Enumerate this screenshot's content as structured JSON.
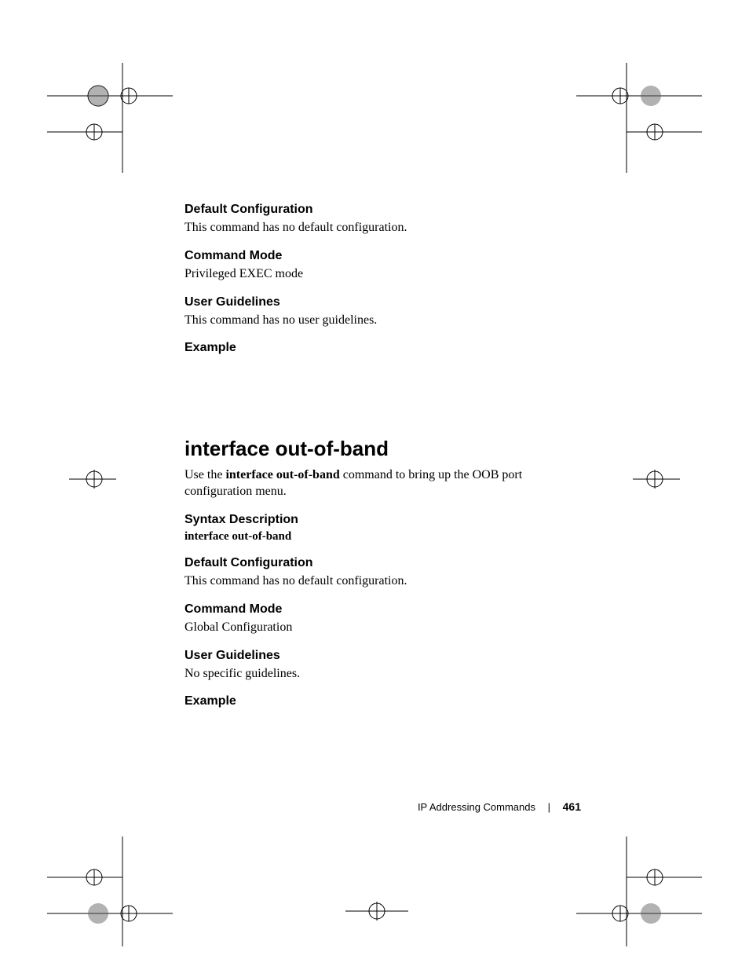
{
  "section1": {
    "default_config_heading": "Default Configuration",
    "default_config_body": "This command has no default configuration.",
    "command_mode_heading": "Command Mode",
    "command_mode_body": "Privileged EXEC mode",
    "user_guidelines_heading": "User Guidelines",
    "user_guidelines_body": "This command has no user guidelines.",
    "example_heading": "Example"
  },
  "section2": {
    "title": "interface out-of-band",
    "intro_pre": "Use the ",
    "intro_bold": "interface out-of-band",
    "intro_post": " command to bring up the OOB port configuration menu.",
    "syntax_heading": "Syntax Description",
    "syntax_line": "interface out-of-band",
    "default_config_heading": "Default Configuration",
    "default_config_body": "This command has no default configuration.",
    "command_mode_heading": "Command Mode",
    "command_mode_body": "Global Configuration",
    "user_guidelines_heading": "User Guidelines",
    "user_guidelines_body": "No specific guidelines.",
    "example_heading": "Example"
  },
  "footer": {
    "chapter": "IP Addressing Commands",
    "separator": "|",
    "page_number": "461"
  }
}
